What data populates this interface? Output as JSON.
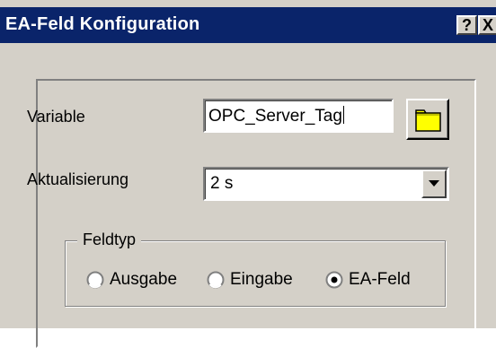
{
  "window": {
    "title": "EA-Feld Konfiguration",
    "help_label": "?",
    "close_label": "X"
  },
  "form": {
    "variable_label": "Variable",
    "variable_value": "OPC_Server_Tag",
    "browse_icon": "folder-icon",
    "update_label": "Aktualisierung",
    "update_value": "2 s"
  },
  "fieldtype": {
    "title": "Feldtyp",
    "options": [
      {
        "label": "Ausgabe",
        "selected": false
      },
      {
        "label": "Eingabe",
        "selected": false
      },
      {
        "label": "EA-Feld",
        "selected": true
      }
    ]
  },
  "colors": {
    "titlebar": "#0a246a",
    "face": "#d4d0c8",
    "folder": "#ffff00"
  }
}
